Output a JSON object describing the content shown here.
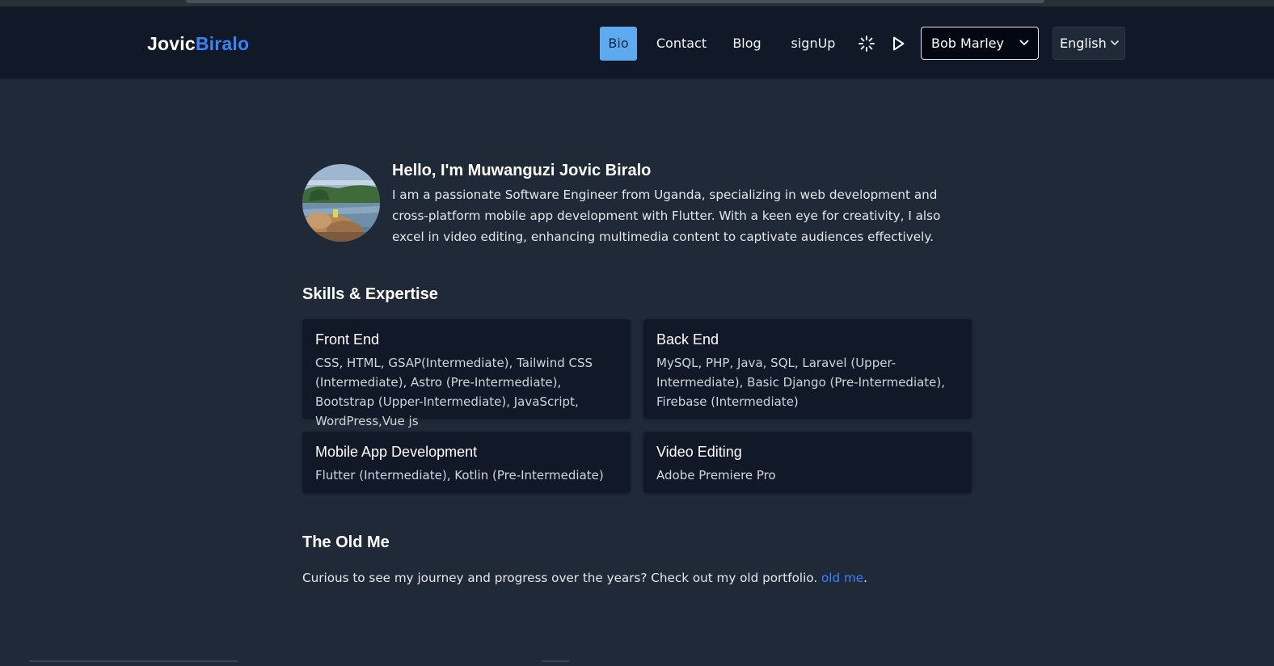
{
  "header": {
    "logo_part1": "Jovic",
    "logo_part2": "Biralo",
    "nav": [
      {
        "label": "Bio",
        "active": true
      },
      {
        "label": "Contact",
        "active": false
      },
      {
        "label": "Blog",
        "active": false
      },
      {
        "label": "signUp",
        "active": false
      }
    ],
    "icons": [
      "loading-spinner-icon",
      "play-icon"
    ],
    "voice_select": {
      "value": "Bob Marley"
    },
    "language_select": {
      "value": "English"
    }
  },
  "intro": {
    "heading": "Hello, I'm Muwanguzi Jovic Biralo",
    "text": "I am a passionate Software Engineer from Uganda, specializing in web development and cross-platform mobile app development with Flutter. With a keen eye for creativity, I also excel in video editing, enhancing multimedia content to captivate audiences effectively."
  },
  "skills": {
    "heading": "Skills & Expertise",
    "cards": [
      {
        "title": "Front End",
        "body": "CSS, HTML, GSAP(Intermediate), Tailwind CSS (Intermediate), Astro (Pre-Intermediate), Bootstrap (Upper-Intermediate), JavaScript, WordPress,Vue js"
      },
      {
        "title": "Back End",
        "body": "MySQL, PHP, Java, SQL, Laravel (Upper-Intermediate), Basic Django (Pre-Intermediate), Firebase (Intermediate)"
      },
      {
        "title": "Mobile App Development",
        "body": "Flutter (Intermediate), Kotlin (Pre-Intermediate)"
      },
      {
        "title": "Video Editing",
        "body": "Adobe Premiere Pro"
      }
    ]
  },
  "old_me": {
    "heading": "The Old Me",
    "text": "Curious to see my journey and progress over the years? Check out my old portfolio. ",
    "link_label": "old me",
    "trailing": "."
  },
  "colors": {
    "background": "#1f2937",
    "header": "#111827",
    "card": "#111827",
    "accent": "#3b82f6",
    "active_nav": "#5eaaf0"
  }
}
